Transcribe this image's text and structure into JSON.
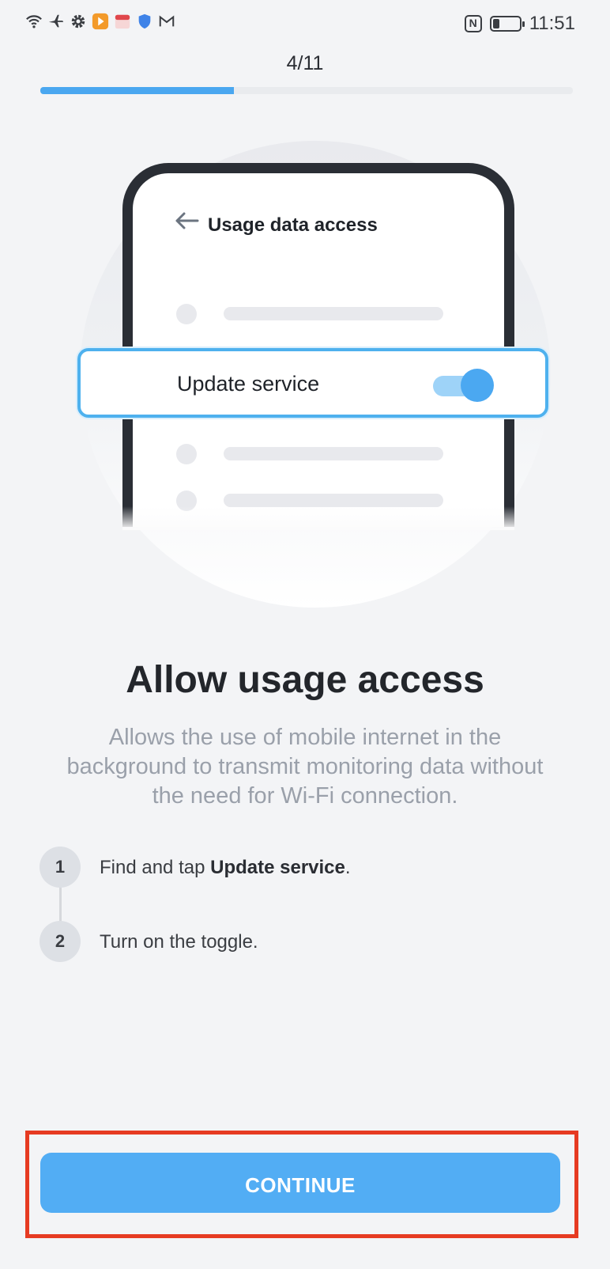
{
  "status_bar": {
    "time": "11:51",
    "left_icons": [
      "wifi-icon",
      "airplane-icon",
      "gear-icon",
      "play-app-icon",
      "calendar-app-icon",
      "shield-icon",
      "gmail-icon"
    ],
    "right_icons": [
      "nfc-icon",
      "battery-icon"
    ],
    "battery_level": 0.35
  },
  "progress": {
    "label": "4/11",
    "fraction": 0.364
  },
  "illustration": {
    "screen_title": "Usage data access",
    "highlight_label": "Update service",
    "toggle_on": true
  },
  "heading": "Allow usage access",
  "description": "Allows the use of mobile internet in the background to transmit monitoring data without the need for Wi-Fi connection.",
  "steps": [
    {
      "number": "1",
      "prefix": "Find and tap ",
      "bold": "Update service",
      "suffix": "."
    },
    {
      "number": "2",
      "prefix": "Turn on the toggle.",
      "bold": "",
      "suffix": ""
    }
  ],
  "continue_label": "CONTINUE",
  "colors": {
    "accent": "#52adf4",
    "highlight_border": "#e63b22"
  }
}
